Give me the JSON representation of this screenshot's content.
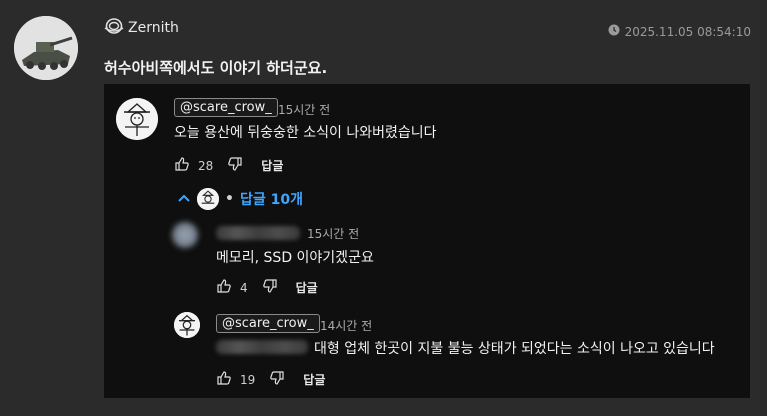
{
  "post": {
    "author": "Zernith",
    "timestamp": "2025.11.05 08:54:10",
    "body": "허수아비쪽에서도 이야기 하더군요."
  },
  "embed": {
    "top_comment": {
      "handle": "@scare_crow_",
      "time": "15시간 전",
      "text": "오늘 용산에 뒤숭숭한 소식이 나와버렸습니다",
      "likes": "28",
      "reply_label": "답글"
    },
    "replies_toggle": {
      "dot": "•",
      "label": "답글 10개"
    },
    "replies": [
      {
        "time": "15시간 전",
        "text": "메모리, SSD 이야기겠군요",
        "likes": "4",
        "reply_label": "답글"
      },
      {
        "handle": "@scare_crow_",
        "time": "14시간 전",
        "text": "대형 업체 한곳이 지불 불능 상태가 되었다는 소식이 나오고 있습니다",
        "likes": "19",
        "reply_label": "답글"
      }
    ]
  },
  "icons": {
    "author_badge": "astronaut-helmet-icon",
    "clock": "clock-icon",
    "like": "thumbs-up-icon",
    "dislike": "thumbs-down-icon",
    "collapse": "chevron-up-icon"
  },
  "colors": {
    "background": "#2b2b2b",
    "embed_background": "#0f0f0f",
    "link_blue": "#3ea6ff"
  }
}
